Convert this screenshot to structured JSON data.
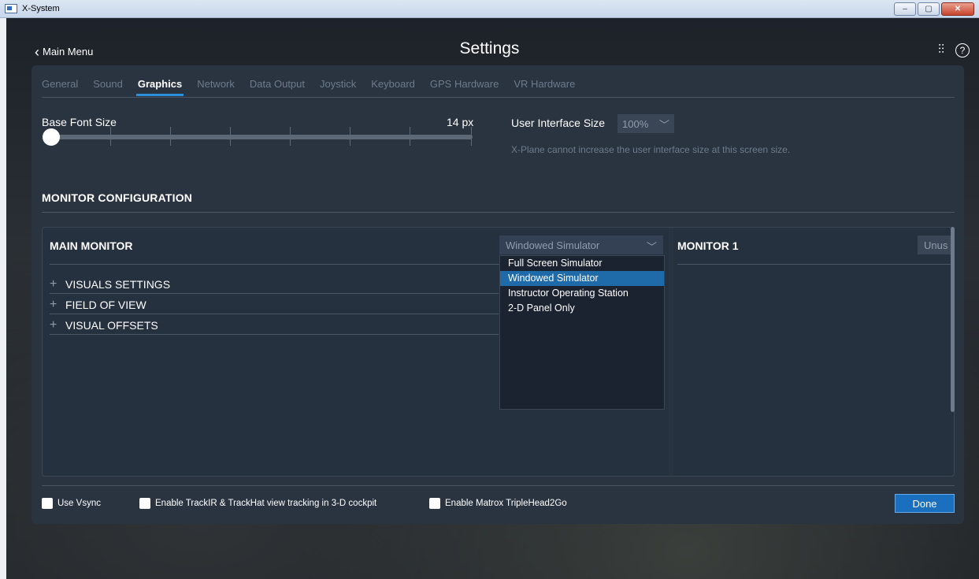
{
  "window": {
    "title": "X-System",
    "controls": [
      "–",
      "▢",
      "✕"
    ]
  },
  "header": {
    "back_label": "Main Menu",
    "title": "Settings",
    "help_glyph": "?",
    "mixer_glyph": "⫶⫶"
  },
  "tabs": [
    {
      "label": "General"
    },
    {
      "label": "Sound"
    },
    {
      "label": "Graphics"
    },
    {
      "label": "Network"
    },
    {
      "label": "Data Output"
    },
    {
      "label": "Joystick"
    },
    {
      "label": "Keyboard"
    },
    {
      "label": "GPS Hardware"
    },
    {
      "label": "VR Hardware"
    }
  ],
  "active_tab": "Graphics",
  "font_size": {
    "label": "Base Font Size",
    "value": "14 px",
    "level": 0
  },
  "ui_size": {
    "label": "User Interface Size",
    "value": "100%",
    "note": "X-Plane cannot increase the user interface size at this screen size."
  },
  "monitor_config": {
    "title": "MONITOR CONFIGURATION",
    "main": {
      "title": "MAIN MONITOR",
      "mode": "Windowed Simulator",
      "options": [
        "Full Screen Simulator",
        "Windowed Simulator",
        "Instructor Operating Station",
        "2-D Panel Only"
      ],
      "sections": [
        "VISUALS SETTINGS",
        "FIELD OF VIEW",
        "VISUAL OFFSETS"
      ]
    },
    "monitor1": {
      "title": "MONITOR 1",
      "mode": "Unus"
    }
  },
  "footer": {
    "vsync": "Use Vsync",
    "trackir": "Enable TrackIR & TrackHat view tracking in 3-D cockpit",
    "matrox": "Enable Matrox TripleHead2Go",
    "done": "Done"
  },
  "colors": {
    "accent": "#2c8fdc",
    "panel": "#2a3441",
    "selected": "#1f6aa8"
  }
}
